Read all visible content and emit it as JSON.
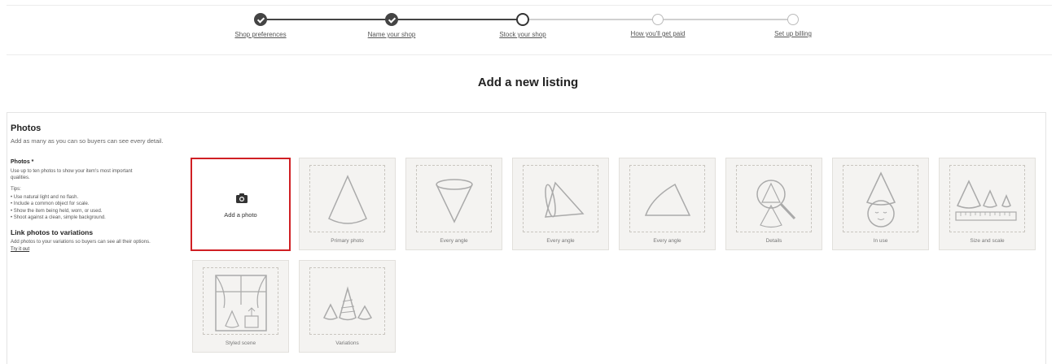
{
  "progress": {
    "steps": [
      {
        "label": "Shop preferences",
        "state": "done"
      },
      {
        "label": "Name your shop",
        "state": "done"
      },
      {
        "label": "Stock your shop",
        "state": "current"
      },
      {
        "label": "How you'll get paid",
        "state": "todo"
      },
      {
        "label": "Set up billing",
        "state": "todo"
      }
    ]
  },
  "page": {
    "title": "Add a new listing"
  },
  "photos": {
    "section_title": "Photos",
    "section_subtitle": "Add as many as you can so buyers can see every detail.",
    "field_label": "Photos *",
    "field_help": "Use up to ten photos to show your item's most important qualities.",
    "tips_label": "Tips:",
    "tips": [
      "Use natural light and no flash.",
      "Include a common object for scale.",
      "Show the item being held, worn, or used.",
      "Shoot against a clean, simple background."
    ],
    "variations_title": "Link photos to variations",
    "variations_help": "Add photos to your variations so buyers can see all their options.",
    "variations_link": "Try it out",
    "add_photo_label": "Add a photo",
    "add_photo_icon": "camera-icon",
    "slots": [
      {
        "caption": "Primary photo",
        "icon": "cone-icon"
      },
      {
        "caption": "Every angle",
        "icon": "cone-top-icon"
      },
      {
        "caption": "Every angle",
        "icon": "cone-side-icon"
      },
      {
        "caption": "Every angle",
        "icon": "cone-flat-icon"
      },
      {
        "caption": "Details",
        "icon": "magnifier-cone-icon"
      },
      {
        "caption": "In use",
        "icon": "cone-hat-face-icon"
      },
      {
        "caption": "Size and scale",
        "icon": "cones-ruler-icon"
      },
      {
        "caption": "Styled scene",
        "icon": "window-scene-icon"
      },
      {
        "caption": "Variations",
        "icon": "cone-variations-icon"
      }
    ],
    "colors": {
      "highlight": "#d01f24",
      "tile_bg": "#f4f3f1"
    }
  }
}
